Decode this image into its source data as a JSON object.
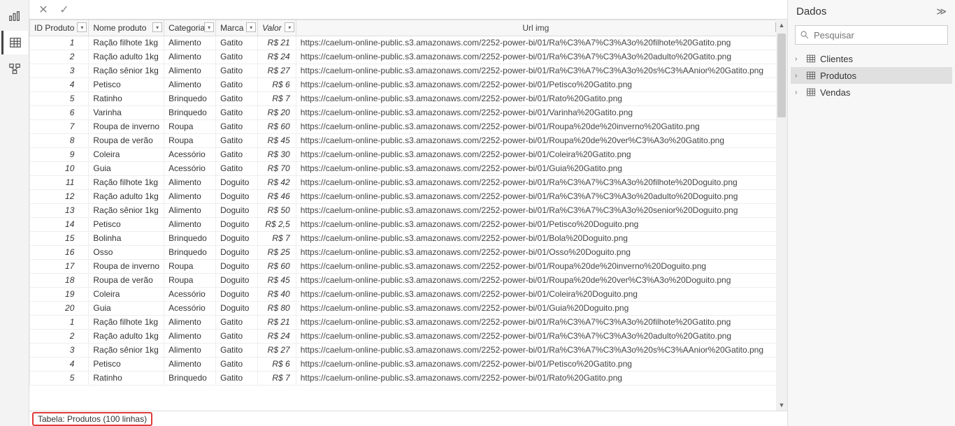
{
  "rightPane": {
    "title": "Dados",
    "searchPlaceholder": "Pesquisar",
    "tables": [
      {
        "name": "Clientes",
        "selected": false
      },
      {
        "name": "Produtos",
        "selected": true
      },
      {
        "name": "Vendas",
        "selected": false
      }
    ]
  },
  "statusBar": {
    "text": "Tabela: Produtos (100 linhas)"
  },
  "columns": [
    {
      "key": "id",
      "label": "ID Produto"
    },
    {
      "key": "nome",
      "label": "Nome produto"
    },
    {
      "key": "cat",
      "label": "Categoria"
    },
    {
      "key": "marca",
      "label": "Marca"
    },
    {
      "key": "valor",
      "label": "Valor"
    },
    {
      "key": "url",
      "label": "Url img"
    }
  ],
  "rows": [
    {
      "id": "1",
      "nome": "Ração filhote 1kg",
      "cat": "Alimento",
      "marca": "Gatito",
      "valor": "R$ 21",
      "url": "https://caelum-online-public.s3.amazonaws.com/2252-power-bi/01/Ra%C3%A7%C3%A3o%20filhote%20Gatito.png"
    },
    {
      "id": "2",
      "nome": "Ração adulto 1kg",
      "cat": "Alimento",
      "marca": "Gatito",
      "valor": "R$ 24",
      "url": "https://caelum-online-public.s3.amazonaws.com/2252-power-bi/01/Ra%C3%A7%C3%A3o%20adulto%20Gatito.png"
    },
    {
      "id": "3",
      "nome": "Ração sênior 1kg",
      "cat": "Alimento",
      "marca": "Gatito",
      "valor": "R$ 27",
      "url": "https://caelum-online-public.s3.amazonaws.com/2252-power-bi/01/Ra%C3%A7%C3%A3o%20s%C3%AAnior%20Gatito.png"
    },
    {
      "id": "4",
      "nome": "Petisco",
      "cat": "Alimento",
      "marca": "Gatito",
      "valor": "R$ 6",
      "url": "https://caelum-online-public.s3.amazonaws.com/2252-power-bi/01/Petisco%20Gatito.png"
    },
    {
      "id": "5",
      "nome": "Ratinho",
      "cat": "Brinquedo",
      "marca": "Gatito",
      "valor": "R$ 7",
      "url": "https://caelum-online-public.s3.amazonaws.com/2252-power-bi/01/Rato%20Gatito.png"
    },
    {
      "id": "6",
      "nome": "Varinha",
      "cat": "Brinquedo",
      "marca": "Gatito",
      "valor": "R$ 20",
      "url": "https://caelum-online-public.s3.amazonaws.com/2252-power-bi/01/Varinha%20Gatito.png"
    },
    {
      "id": "7",
      "nome": "Roupa de inverno",
      "cat": "Roupa",
      "marca": "Gatito",
      "valor": "R$ 60",
      "url": "https://caelum-online-public.s3.amazonaws.com/2252-power-bi/01/Roupa%20de%20inverno%20Gatito.png"
    },
    {
      "id": "8",
      "nome": "Roupa de verão",
      "cat": "Roupa",
      "marca": "Gatito",
      "valor": "R$ 45",
      "url": "https://caelum-online-public.s3.amazonaws.com/2252-power-bi/01/Roupa%20de%20ver%C3%A3o%20Gatito.png"
    },
    {
      "id": "9",
      "nome": "Coleira",
      "cat": "Acessório",
      "marca": "Gatito",
      "valor": "R$ 30",
      "url": "https://caelum-online-public.s3.amazonaws.com/2252-power-bi/01/Coleira%20Gatito.png"
    },
    {
      "id": "10",
      "nome": "Guia",
      "cat": "Acessório",
      "marca": "Gatito",
      "valor": "R$ 70",
      "url": "https://caelum-online-public.s3.amazonaws.com/2252-power-bi/01/Guia%20Gatito.png"
    },
    {
      "id": "11",
      "nome": "Ração filhote 1kg",
      "cat": "Alimento",
      "marca": "Doguito",
      "valor": "R$ 42",
      "url": "https://caelum-online-public.s3.amazonaws.com/2252-power-bi/01/Ra%C3%A7%C3%A3o%20filhote%20Doguito.png"
    },
    {
      "id": "12",
      "nome": "Ração adulto 1kg",
      "cat": "Alimento",
      "marca": "Doguito",
      "valor": "R$ 46",
      "url": "https://caelum-online-public.s3.amazonaws.com/2252-power-bi/01/Ra%C3%A7%C3%A3o%20adulto%20Doguito.png"
    },
    {
      "id": "13",
      "nome": "Ração sênior 1kg",
      "cat": "Alimento",
      "marca": "Doguito",
      "valor": "R$ 50",
      "url": "https://caelum-online-public.s3.amazonaws.com/2252-power-bi/01/Ra%C3%A7%C3%A3o%20senior%20Doguito.png"
    },
    {
      "id": "14",
      "nome": "Petisco",
      "cat": "Alimento",
      "marca": "Doguito",
      "valor": "R$ 2,5",
      "url": "https://caelum-online-public.s3.amazonaws.com/2252-power-bi/01/Petisco%20Doguito.png"
    },
    {
      "id": "15",
      "nome": "Bolinha",
      "cat": "Brinquedo",
      "marca": "Doguito",
      "valor": "R$ 7",
      "url": "https://caelum-online-public.s3.amazonaws.com/2252-power-bi/01/Bola%20Doguito.png"
    },
    {
      "id": "16",
      "nome": "Osso",
      "cat": "Brinquedo",
      "marca": "Doguito",
      "valor": "R$ 25",
      "url": "https://caelum-online-public.s3.amazonaws.com/2252-power-bi/01/Osso%20Doguito.png"
    },
    {
      "id": "17",
      "nome": "Roupa de inverno",
      "cat": "Roupa",
      "marca": "Doguito",
      "valor": "R$ 60",
      "url": "https://caelum-online-public.s3.amazonaws.com/2252-power-bi/01/Roupa%20de%20inverno%20Doguito.png"
    },
    {
      "id": "18",
      "nome": "Roupa de verão",
      "cat": "Roupa",
      "marca": "Doguito",
      "valor": "R$ 45",
      "url": "https://caelum-online-public.s3.amazonaws.com/2252-power-bi/01/Roupa%20de%20ver%C3%A3o%20Doguito.png"
    },
    {
      "id": "19",
      "nome": "Coleira",
      "cat": "Acessório",
      "marca": "Doguito",
      "valor": "R$ 40",
      "url": "https://caelum-online-public.s3.amazonaws.com/2252-power-bi/01/Coleira%20Doguito.png"
    },
    {
      "id": "20",
      "nome": "Guia",
      "cat": "Acessório",
      "marca": "Doguito",
      "valor": "R$ 80",
      "url": "https://caelum-online-public.s3.amazonaws.com/2252-power-bi/01/Guia%20Doguito.png"
    },
    {
      "id": "1",
      "nome": "Ração filhote 1kg",
      "cat": "Alimento",
      "marca": "Gatito",
      "valor": "R$ 21",
      "url": "https://caelum-online-public.s3.amazonaws.com/2252-power-bi/01/Ra%C3%A7%C3%A3o%20filhote%20Gatito.png"
    },
    {
      "id": "2",
      "nome": "Ração adulto 1kg",
      "cat": "Alimento",
      "marca": "Gatito",
      "valor": "R$ 24",
      "url": "https://caelum-online-public.s3.amazonaws.com/2252-power-bi/01/Ra%C3%A7%C3%A3o%20adulto%20Gatito.png"
    },
    {
      "id": "3",
      "nome": "Ração sênior 1kg",
      "cat": "Alimento",
      "marca": "Gatito",
      "valor": "R$ 27",
      "url": "https://caelum-online-public.s3.amazonaws.com/2252-power-bi/01/Ra%C3%A7%C3%A3o%20s%C3%AAnior%20Gatito.png"
    },
    {
      "id": "4",
      "nome": "Petisco",
      "cat": "Alimento",
      "marca": "Gatito",
      "valor": "R$ 6",
      "url": "https://caelum-online-public.s3.amazonaws.com/2252-power-bi/01/Petisco%20Gatito.png"
    },
    {
      "id": "5",
      "nome": "Ratinho",
      "cat": "Brinquedo",
      "marca": "Gatito",
      "valor": "R$ 7",
      "url": "https://caelum-online-public.s3.amazonaws.com/2252-power-bi/01/Rato%20Gatito.png"
    }
  ]
}
